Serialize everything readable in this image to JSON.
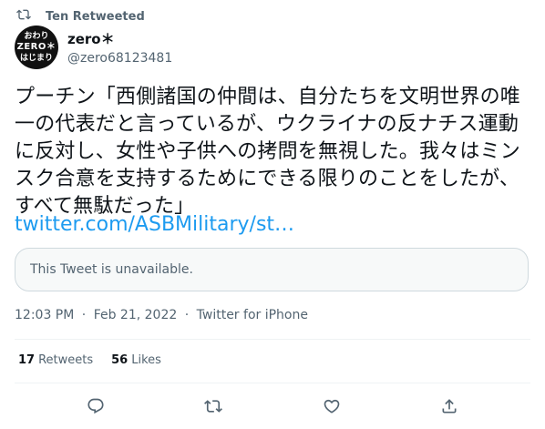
{
  "retweet_header": {
    "icon": "retweet-icon",
    "label": "Ten Retweeted"
  },
  "author": {
    "avatar": {
      "line1": "おわり",
      "line2": "ZERO＊",
      "line3": "はじまり"
    },
    "display_name": "zero＊",
    "handle": "@zero68123481"
  },
  "tweet": {
    "text": "プーチン「西側諸国の仲間は、自分たちを文明世界の唯一の代表だと言っているが、ウクライナの反ナチス運動に反対し、女性や子供への拷問を無視した。我々はミンスク合意を支持するためにできる限りのことをしたが、すべて無駄だった」",
    "link": "twitter.com/ASBMilitary/st…",
    "quote_unavailable": "This Tweet is unavailable."
  },
  "meta": {
    "time": "12:03 PM",
    "date": "Feb 21, 2022",
    "source": "Twitter for iPhone",
    "sep": "·"
  },
  "stats": {
    "retweets_count": "17",
    "retweets_label": "Retweets",
    "likes_count": "56",
    "likes_label": "Likes"
  },
  "actions": [
    "reply-icon",
    "retweet-icon",
    "like-icon",
    "share-icon"
  ],
  "colors": {
    "link": "#1d9bf0",
    "muted": "#536471",
    "text": "#0f1419",
    "border": "#cfd9de"
  }
}
